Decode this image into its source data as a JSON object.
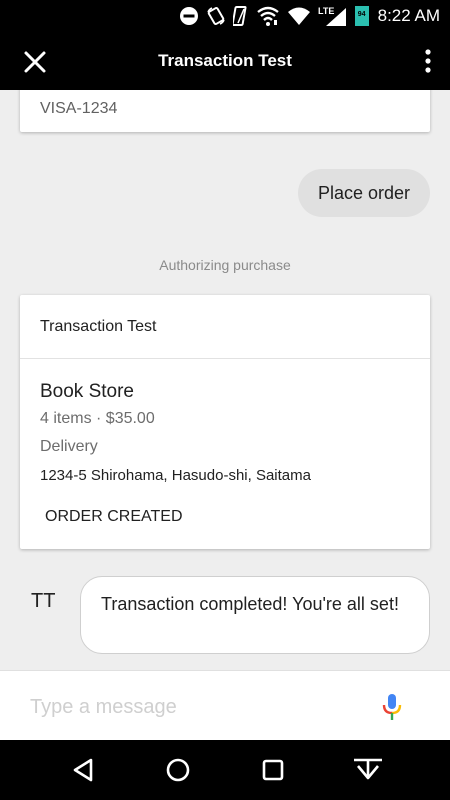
{
  "status_bar": {
    "time": "8:22 AM",
    "icons": [
      "do-not-disturb-icon",
      "rotate-icon",
      "vibrate-icon",
      "wifi-calling-icon",
      "wifi-icon",
      "lte-signal-icon",
      "battery-icon"
    ],
    "network_label": "LTE",
    "battery_level": "94"
  },
  "app_bar": {
    "title": "Transaction Test",
    "close_icon": "close-icon",
    "menu_icon": "more-vert-icon"
  },
  "conversation": {
    "previous_card": {
      "payment_method": "VISA-1234"
    },
    "user_message": "Place order",
    "status_note": "Authorizing purchase",
    "order_card": {
      "header": "Transaction Test",
      "store_name": "Book Store",
      "summary": "4 items · $35.00",
      "fulfillment": "Delivery",
      "address": "1234-5 Shirohama, Hasudo-shi, Saitama",
      "status": "ORDER CREATED"
    },
    "bot": {
      "avatar_label": "TT",
      "message": "Transaction completed! You're all set!"
    }
  },
  "input": {
    "placeholder": "Type a message",
    "value": "",
    "mic_icon": "mic-icon"
  },
  "nav_bar": {
    "icons": [
      "back-icon",
      "home-icon",
      "recents-icon",
      "hide-keyboard-icon"
    ]
  },
  "colors": {
    "bar_background": "#000000",
    "screen_background": "#eeeeee",
    "user_bubble": "#e0e0e0",
    "mic_blue": "#4285f4",
    "mic_red": "#ea4335",
    "mic_yellow": "#fbbc05",
    "mic_green": "#34a853"
  }
}
